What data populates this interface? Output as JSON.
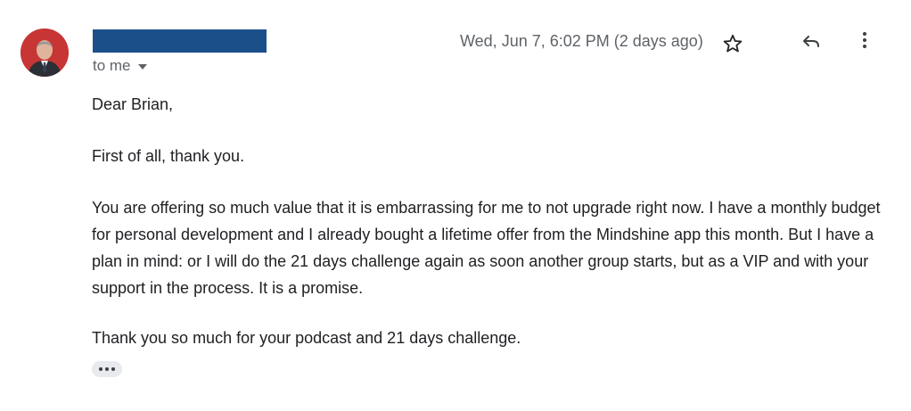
{
  "sender": {
    "name_redacted": ""
  },
  "recipient_label": "to me",
  "date_text": "Wed, Jun 7, 6:02 PM (2 days ago)",
  "icons": {
    "star": "star-icon",
    "reply": "reply-icon",
    "more": "more-vert-icon",
    "expand": "ellipsis-icon"
  },
  "colors": {
    "redaction": "#1b4f8a",
    "avatar_bg": "#c73535"
  },
  "message": {
    "greeting": "Dear Brian,",
    "paragraph1": "First of all, thank you.",
    "paragraph2": "You are offering so much value that it is embarrassing for me to not upgrade right now. I have a monthly budget for personal development and I already bought a lifetime offer from the Mindshine app this month. But I have a plan in mind: or I will do the 21 days challenge again as soon another group starts, but as a VIP and with your support in the process. It is a promise.",
    "paragraph3": "Thank you so much for your podcast and 21 days challenge."
  }
}
